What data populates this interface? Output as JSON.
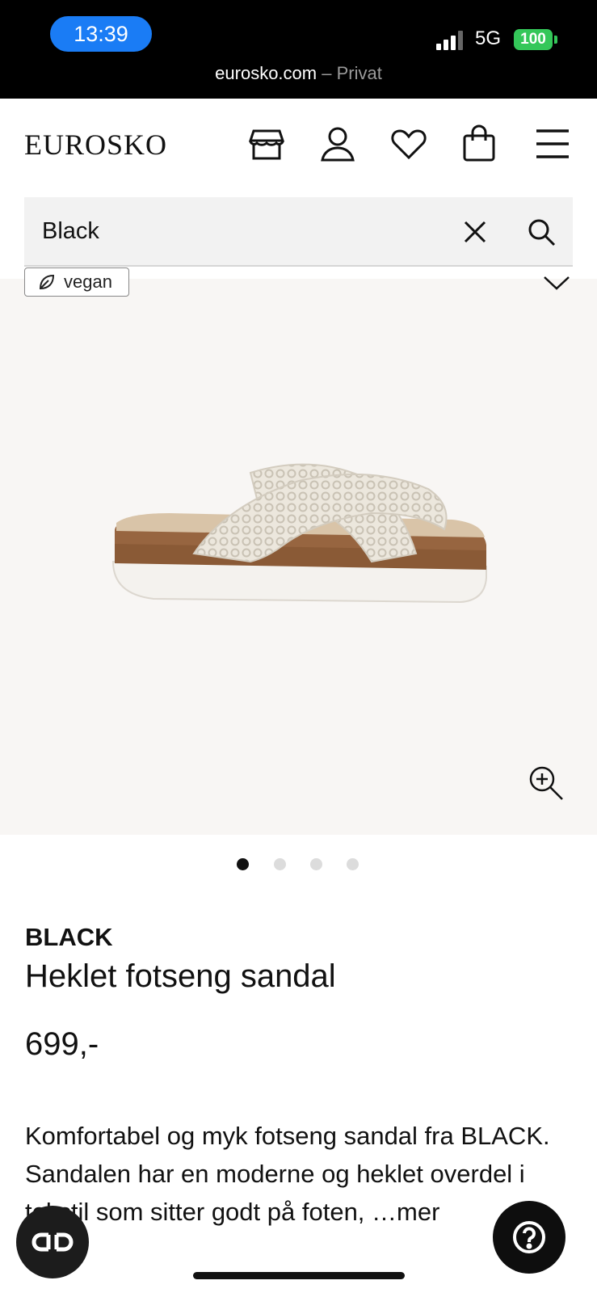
{
  "status": {
    "time": "13:39",
    "network": "5G",
    "battery": "100",
    "url": "eurosko.com",
    "mode": "– Privat"
  },
  "header": {
    "logo": "EUROSKO",
    "icons": [
      "store-icon",
      "account-icon",
      "wishlist-heart-icon",
      "cart-bag-icon",
      "menu-icon"
    ]
  },
  "search": {
    "value": "Black"
  },
  "gallery": {
    "badge": "vegan",
    "slide_count": 4,
    "active_slide": 1
  },
  "product": {
    "brand": "BLACK",
    "name": "Heklet fotseng sandal",
    "price": "699,-",
    "description": "Komfortabel og myk fotseng sandal fra BLACK. Sandalen har en moderne og heklet overdel i tekstil som sitter godt på foten, …mer"
  },
  "colors": {
    "status_bg": "#000000",
    "time_pill": "#1a7cf5",
    "battery": "#34c759",
    "gallery_bg": "#f8f6f4"
  }
}
